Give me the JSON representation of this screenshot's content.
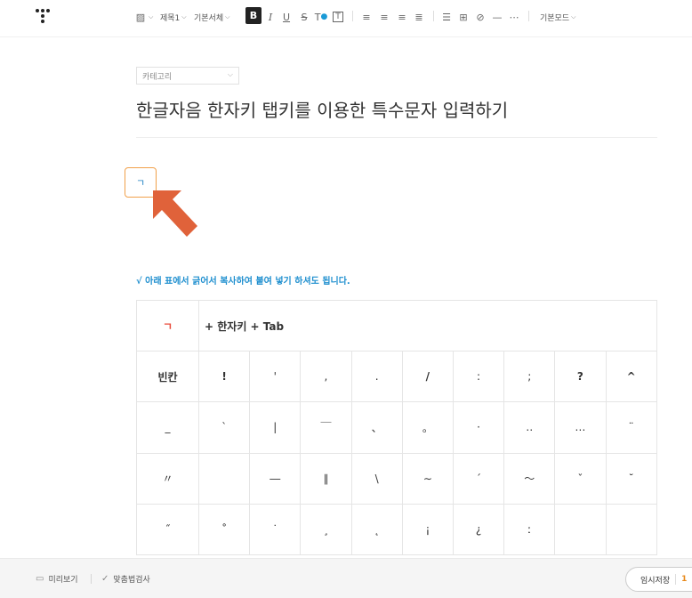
{
  "toolbar": {
    "heading_label": "제목1",
    "font_label": "기본서체",
    "bold_label": "B",
    "italic_label": "I",
    "underline_label": "U",
    "strike_label": "S",
    "mode_label": "기본모드"
  },
  "editor": {
    "category_placeholder": "카테고리",
    "title": "한글자음 한자키 탭키를 이용한 특수문자 입력하기",
    "highlight_char": "ㄱ",
    "notice": "√ 아래 표에서 긁어서 복사하여 붙여 넣기 하셔도 됩니다.",
    "arrow_color": "#e0623a"
  },
  "char_table": {
    "key_char": "ㄱ",
    "key_hint": "+ 한자키 + Tab",
    "rows": [
      [
        "빈칸",
        "!",
        "'",
        ",",
        ".",
        "/",
        ":",
        ";",
        "?",
        "^"
      ],
      [
        "_",
        "`",
        "|",
        "￣",
        "、",
        "。",
        "·",
        "‥",
        "…",
        "¨"
      ],
      [
        "〃",
        "",
        "―",
        "∥",
        "\\",
        "∼",
        "´",
        "～",
        "ˇ",
        "˘"
      ],
      [
        "˝",
        "˚",
        "˙",
        "¸",
        "˛",
        "¡",
        "¿",
        "ː",
        "",
        ""
      ]
    ]
  },
  "bottombar": {
    "preview_label": "미리보기",
    "spellcheck_label": "맞춤법검사",
    "save_label": "임시저장",
    "save_count": "1"
  }
}
